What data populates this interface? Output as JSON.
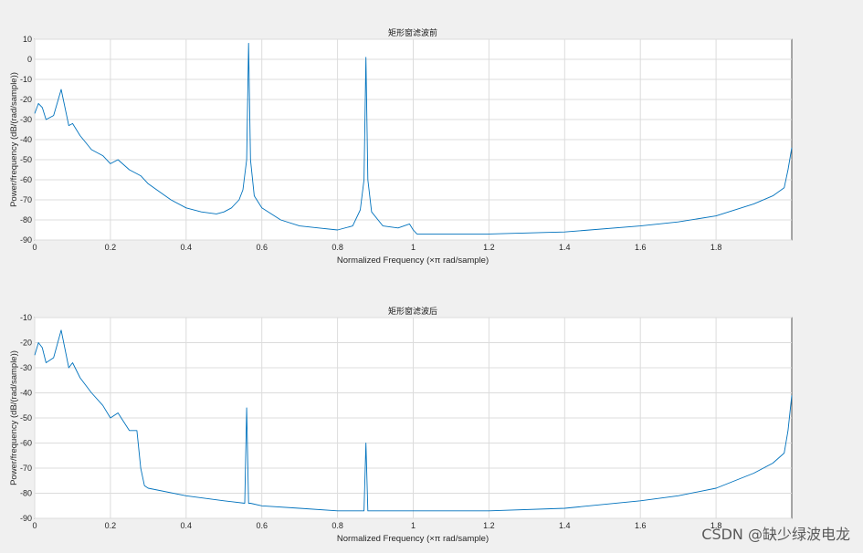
{
  "watermark": "CSDN @缺少绿波电龙",
  "trace_color": "#0072BD",
  "chart_data": [
    {
      "type": "line",
      "title": "矩形窗滤波前",
      "xlabel": "Normalized Frequency  (×π rad/sample)",
      "ylabel": "Power/frequency (dB/(rad/sample))",
      "xlim": [
        0,
        2
      ],
      "ylim": [
        -90,
        10
      ],
      "xticks": [
        "0",
        "0.2",
        "0.4",
        "0.6",
        "0.8",
        "1",
        "1.2",
        "1.4",
        "1.6",
        "1.8"
      ],
      "yticks": [
        "10",
        "0",
        "-10",
        "-20",
        "-30",
        "-40",
        "-50",
        "-60",
        "-70",
        "-80",
        "-90"
      ],
      "grid": true,
      "series": [
        {
          "x": [
            0,
            0.01,
            0.02,
            0.03,
            0.05,
            0.07,
            0.09,
            0.1,
            0.12,
            0.15,
            0.18,
            0.2,
            0.22,
            0.25,
            0.28,
            0.3,
            0.33,
            0.36,
            0.4,
            0.44,
            0.48,
            0.5,
            0.52,
            0.54,
            0.55,
            0.56,
            0.565,
            0.57,
            0.58,
            0.6,
            0.65,
            0.7,
            0.75,
            0.8,
            0.84,
            0.86,
            0.87,
            0.875,
            0.88,
            0.89,
            0.92,
            0.96,
            0.99,
            1.0,
            1.01,
            1.05,
            1.2,
            1.4,
            1.6,
            1.7,
            1.8,
            1.9,
            1.95,
            1.98,
            1.99,
            2.0
          ],
          "y": [
            -27,
            -22,
            -24,
            -30,
            -28,
            -15,
            -33,
            -32,
            -38,
            -45,
            -48,
            -52,
            -50,
            -55,
            -58,
            -62,
            -66,
            -70,
            -74,
            -76,
            -77,
            -76,
            -74,
            -70,
            -65,
            -50,
            8,
            -50,
            -68,
            -74,
            -80,
            -83,
            -84,
            -85,
            -83,
            -75,
            -60,
            1,
            -60,
            -76,
            -83,
            -84,
            -82,
            -85,
            -87,
            -87,
            -87,
            -86,
            -83,
            -81,
            -78,
            -72,
            -68,
            -64,
            -55,
            -44
          ]
        }
      ]
    },
    {
      "type": "line",
      "title": "矩形窗滤波后",
      "xlabel": "Normalized Frequency  (×π rad/sample)",
      "ylabel": "Power/frequency (dB/(rad/sample))",
      "xlim": [
        0,
        2
      ],
      "ylim": [
        -90,
        -10
      ],
      "xticks": [
        "0",
        "0.2",
        "0.4",
        "0.6",
        "0.8",
        "1",
        "1.2",
        "1.4",
        "1.6",
        "1.8"
      ],
      "yticks": [
        "-10",
        "-20",
        "-30",
        "-40",
        "-50",
        "-60",
        "-70",
        "-80",
        "-90"
      ],
      "grid": true,
      "series": [
        {
          "x": [
            0,
            0.01,
            0.02,
            0.03,
            0.05,
            0.07,
            0.09,
            0.1,
            0.12,
            0.15,
            0.18,
            0.2,
            0.22,
            0.25,
            0.27,
            0.28,
            0.29,
            0.3,
            0.4,
            0.5,
            0.555,
            0.56,
            0.565,
            0.57,
            0.6,
            0.7,
            0.8,
            0.87,
            0.875,
            0.88,
            0.885,
            0.9,
            1.0,
            1.2,
            1.4,
            1.6,
            1.7,
            1.8,
            1.9,
            1.95,
            1.98,
            1.99,
            2.0
          ],
          "y": [
            -25,
            -20,
            -22,
            -28,
            -26,
            -15,
            -30,
            -28,
            -34,
            -40,
            -45,
            -50,
            -48,
            -55,
            -55,
            -70,
            -77,
            -78,
            -81,
            -83,
            -84,
            -46,
            -84,
            -84,
            -85,
            -86,
            -87,
            -87,
            -60,
            -87,
            -87,
            -87,
            -87,
            -87,
            -86,
            -83,
            -81,
            -78,
            -72,
            -68,
            -64,
            -55,
            -41
          ]
        }
      ]
    }
  ]
}
